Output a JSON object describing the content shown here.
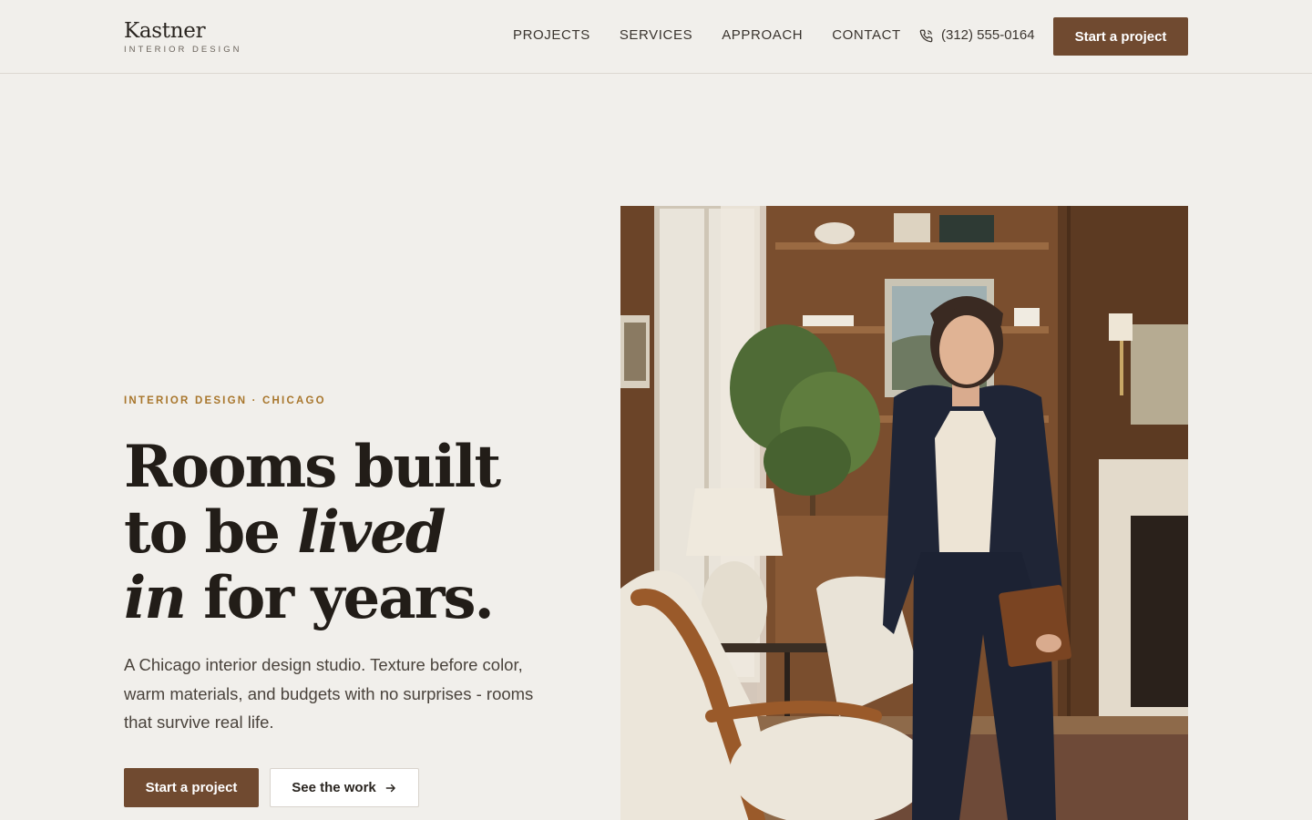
{
  "header": {
    "logo_name": "Kastner",
    "logo_sub": "INTERIOR DESIGN",
    "nav": [
      "PROJECTS",
      "SERVICES",
      "APPROACH",
      "CONTACT"
    ],
    "phone": "(312) 555-0164",
    "phone_icon": "phone-icon",
    "cta_label": "Start a project"
  },
  "hero": {
    "eyebrow": "INTERIOR DESIGN · CHICAGO",
    "headline": {
      "line1": "Rooms built",
      "line2_a": "to be ",
      "line2_em": "lived",
      "line3_em": "in",
      "line3_b": " for years."
    },
    "lede": "A Chicago interior design studio. Texture before color, warm materials, and budgets with no surprises - rooms that survive real life.",
    "primary_cta": "Start a project",
    "secondary_cta": "See the work",
    "secondary_cta_icon": "arrow-right-icon"
  },
  "colors": {
    "background": "#f1efeb",
    "accent": "#704a30",
    "eyebrow": "#a8762c",
    "text": "#221d18"
  }
}
